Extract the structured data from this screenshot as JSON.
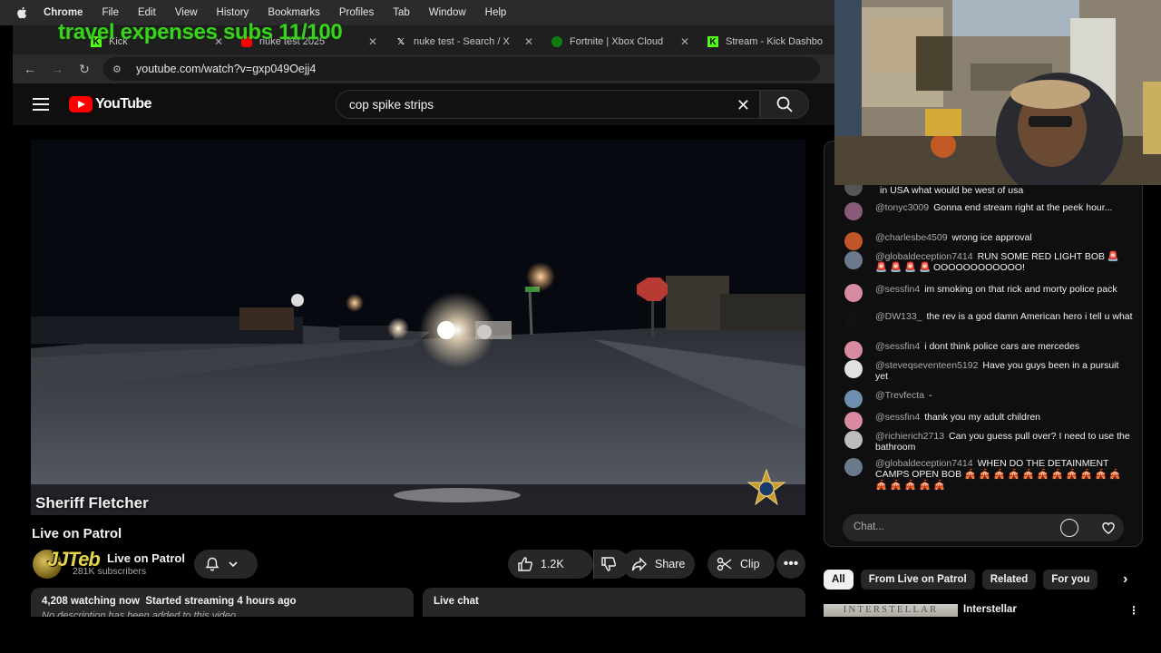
{
  "menubar": {
    "app": "Chrome",
    "items": [
      "File",
      "Edit",
      "View",
      "History",
      "Bookmarks",
      "Profiles",
      "Tab",
      "Window",
      "Help"
    ]
  },
  "overlay": {
    "text": "travel expenses subs 11/100"
  },
  "tabs": [
    {
      "label": "Kick",
      "icon": "kick-icon"
    },
    {
      "label": "nuke test 2025",
      "icon": "youtube-icon"
    },
    {
      "label": "nuke test - Search / X",
      "icon": "x-icon"
    },
    {
      "label": "Fortnite | Xbox Cloud",
      "icon": "xbox-icon"
    },
    {
      "label": "Stream - Kick Dashbo",
      "icon": "kick-icon"
    }
  ],
  "address": {
    "url": "youtube.com/watch?v=gxp049Oejj4"
  },
  "youtube": {
    "logo": "YouTube",
    "search_query": "cop spike strips"
  },
  "video": {
    "channel_overlay": "Sheriff Fletcher",
    "title": "Live on Patrol",
    "sticker": "JJTeb",
    "channel_name": "Live on Patrol",
    "subscribers": "281K subscribers",
    "likes": "1.2K",
    "share_label": "Share",
    "clip_label": "Clip",
    "watching": "4,208 watching now",
    "started": "Started streaming 4 hours ago",
    "no_description": "No description has been added to this video.",
    "live_chat_label": "Live chat"
  },
  "chat": {
    "messages": [
      {
        "author": "",
        "text": "in USA what would be west of usa",
        "avatar_color": "#555555"
      },
      {
        "author": "@tonyc3009",
        "text": "Gonna end stream right at the peek hour...",
        "avatar_color": "#8a5a7a"
      },
      {
        "author": "@charlesbe4509",
        "text": "wrong ice approval",
        "avatar_color": "#c0562a"
      },
      {
        "author": "@globaldeception7414",
        "text": "RUN SOME RED LIGHT BOB 🚨 🚨 🚨 🚨 🚨 OOOOOOOOOOOO!",
        "avatar_color": "#6a7a8a"
      },
      {
        "author": "@sessfin4",
        "text": "im smoking on that rick and morty police pack",
        "avatar_color": "#d88aa0"
      },
      {
        "author": "@DW133_",
        "text": "the rev is a god damn American hero i tell u what",
        "avatar_color": "#111111"
      },
      {
        "author": "@sessfin4",
        "text": "i dont think police cars are mercedes",
        "avatar_color": "#d88aa0"
      },
      {
        "author": "@steveqseventeen5192",
        "text": "Have you guys been in a pursuit yet",
        "avatar_color": "#e0e0e0"
      },
      {
        "author": "@Trevfecta",
        "text": "-",
        "avatar_color": "#6f8fb0"
      },
      {
        "author": "@sessfin4",
        "text": "thank you my adult children",
        "avatar_color": "#d88aa0"
      },
      {
        "author": "@richierich2713",
        "text": "Can you guess pull over? I need to use the bathroom",
        "avatar_color": "#bdbdbd"
      },
      {
        "author": "@globaldeception7414",
        "text": "WHEN DO THE DETAINMENT CAMPS OPEN BOB 🎪 🎪 🎪 🎪 🎪 🎪 🎪 🎪 🎪 🎪 🎪 🎪 🎪 🎪 🎪 🎪",
        "avatar_color": "#6a7a8a"
      }
    ],
    "input_placeholder": "Chat..."
  },
  "chips": [
    "All",
    "From Live on Patrol",
    "Related",
    "For you"
  ],
  "recommendation": {
    "thumb_text": "INTERSTELLAR",
    "title": "Interstellar"
  }
}
